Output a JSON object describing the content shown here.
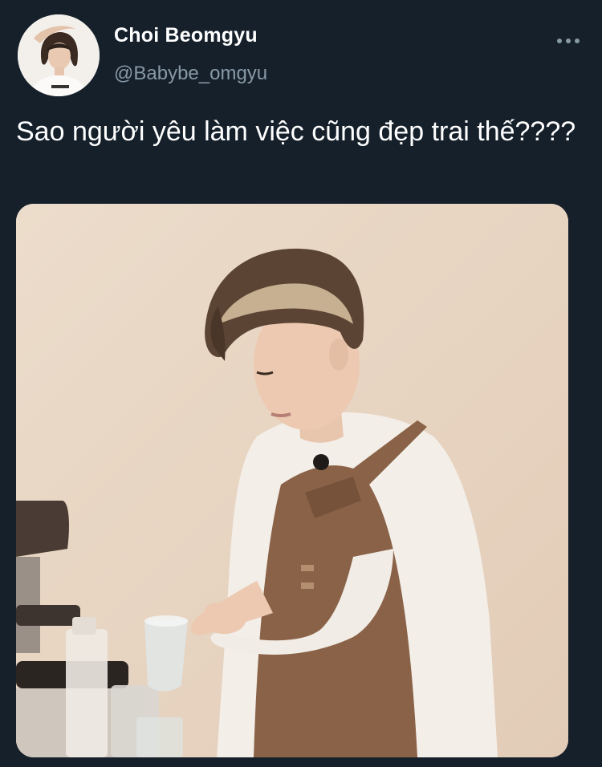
{
  "tweet": {
    "display_name": "Choi Beomgyu",
    "handle": "@Babybe_omgyu",
    "text": "Sao người yêu làm việc cũng đẹp trai thế????",
    "avatar_icon": "profile-photo",
    "more_icon": "more-horizontal-icon"
  },
  "colors": {
    "background": "#15202b",
    "text_primary": "#ffffff",
    "text_secondary": "#8899a6"
  }
}
